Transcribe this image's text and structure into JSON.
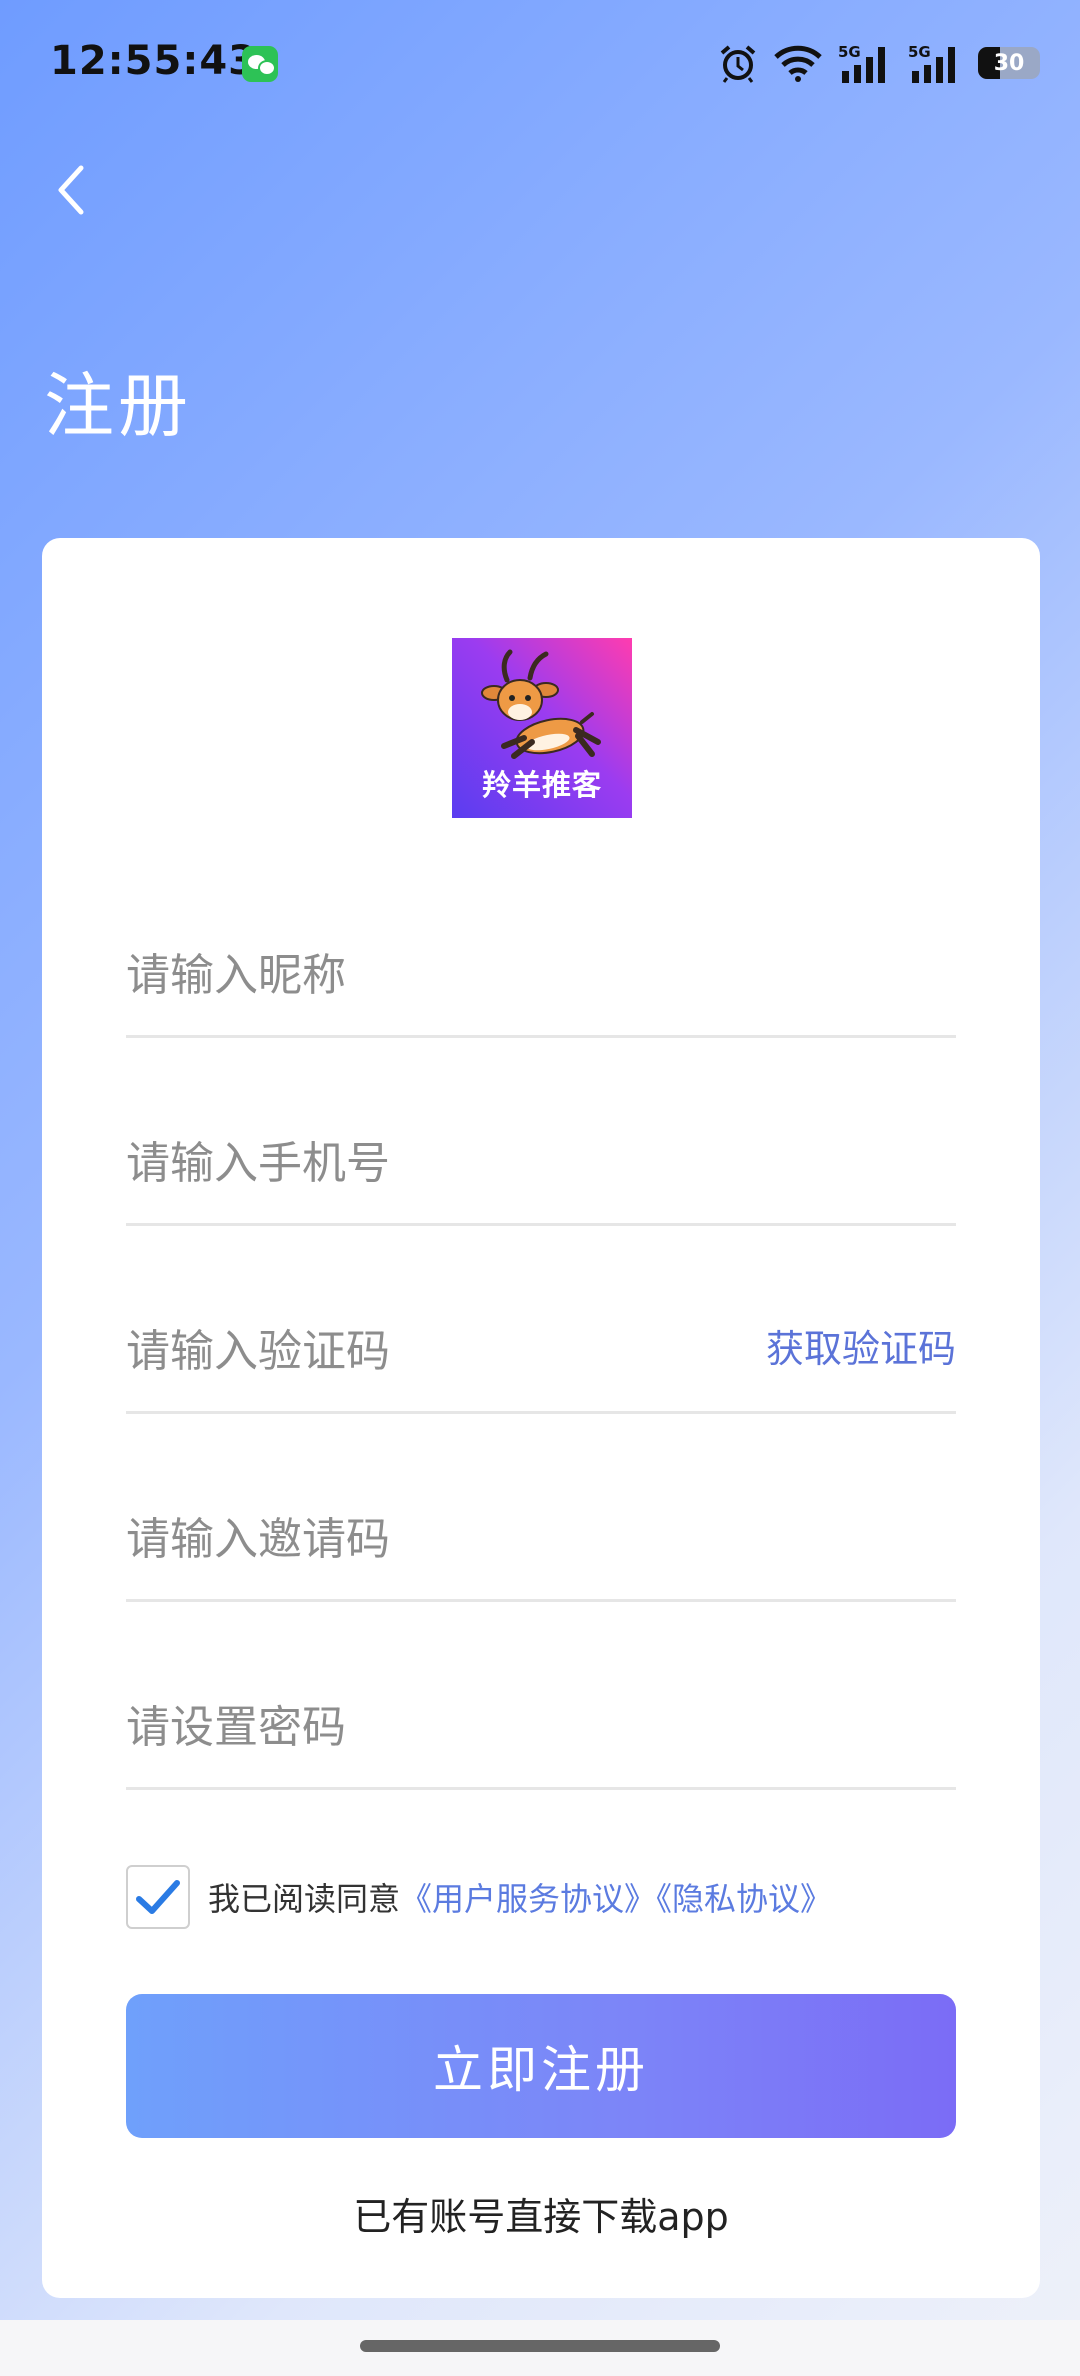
{
  "status_bar": {
    "time": "12:55:43",
    "battery": "30",
    "network_1": "5G",
    "network_2": "5G"
  },
  "page": {
    "title": "注册"
  },
  "logo": {
    "text": "羚羊推客"
  },
  "form": {
    "nickname_placeholder": "请输入昵称",
    "phone_placeholder": "请输入手机号",
    "code_placeholder": "请输入验证码",
    "get_code_label": "获取验证码",
    "invite_placeholder": "请输入邀请码",
    "password_placeholder": "请设置密码"
  },
  "agreement": {
    "checked": true,
    "prefix": "我已阅读同意",
    "user_agreement": "《用户服务协议》",
    "privacy_agreement": "《隐私协议》"
  },
  "actions": {
    "register_label": "立即注册",
    "download_label": "已有账号直接下载app"
  },
  "colors": {
    "accent": "#5b7be0",
    "button_start": "#6fa0fb",
    "button_end": "#7b6cf6"
  }
}
